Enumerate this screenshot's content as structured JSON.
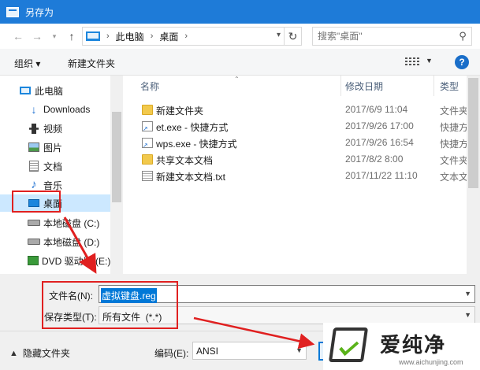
{
  "window": {
    "title": "另存为"
  },
  "address": {
    "crumbs": [
      "此电脑",
      "桌面"
    ],
    "search_placeholder": "搜索\"桌面\""
  },
  "toolbar": {
    "organize_label": "组织 ▾",
    "new_folder_label": "新建文件夹"
  },
  "sidebar": {
    "items": [
      {
        "label": "此电脑",
        "icon": "computer-icon"
      },
      {
        "label": "Downloads",
        "icon": "download-arrow-icon"
      },
      {
        "label": "视频",
        "icon": "video-icon"
      },
      {
        "label": "图片",
        "icon": "picture-icon"
      },
      {
        "label": "文档",
        "icon": "document-icon"
      },
      {
        "label": "音乐",
        "icon": "music-note-icon"
      },
      {
        "label": "桌面",
        "icon": "desktop-icon",
        "selected": true
      },
      {
        "label": "本地磁盘 (C:)",
        "icon": "drive-icon"
      },
      {
        "label": "本地磁盘 (D:)",
        "icon": "drive-icon"
      },
      {
        "label": "DVD 驱动器 (E:)",
        "icon": "dvd-icon"
      }
    ]
  },
  "columns": {
    "name": "名称",
    "date": "修改日期",
    "type": "类型"
  },
  "files": [
    {
      "name": "新建文件夹",
      "date": "2017/6/9 11:04",
      "type": "文件夹",
      "icon": "folder-icon"
    },
    {
      "name": "et.exe - 快捷方式",
      "date": "2017/9/26 17:00",
      "type": "快捷方式",
      "icon": "shortcut-icon"
    },
    {
      "name": "wps.exe - 快捷方式",
      "date": "2017/9/26 16:54",
      "type": "快捷方式",
      "icon": "shortcut-icon"
    },
    {
      "name": "共享文本文档",
      "date": "2017/8/2 8:00",
      "type": "文件夹",
      "icon": "folder-icon"
    },
    {
      "name": "新建文本文档.txt",
      "date": "2017/11/22 11:10",
      "type": "文本文档",
      "icon": "text-file-icon"
    }
  ],
  "form": {
    "filename_label": "文件名(N):",
    "filename_value": "虚拟键盘.reg",
    "filetype_label": "保存类型(T):",
    "filetype_value": "所有文件  (*.*)",
    "encoding_label": "编码(E):",
    "encoding_value": "ANSI",
    "hide_folders_label": "隐藏文件夹"
  },
  "watermark": {
    "brand": "爱纯净",
    "url": "www.aichunjing.com"
  },
  "colors": {
    "titlebar": "#1e7bd8",
    "selection": "#0078d7",
    "annotation": "#e02020",
    "watermark_check": "#5ab31a"
  }
}
